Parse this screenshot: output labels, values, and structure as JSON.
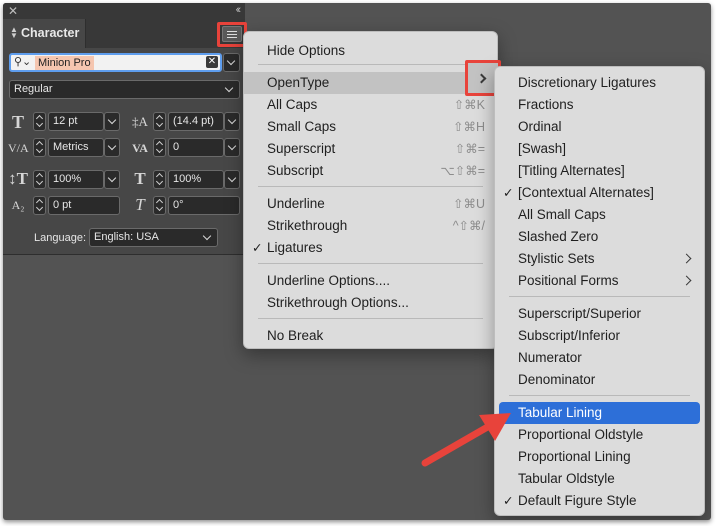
{
  "panel": {
    "tab_label": "Character",
    "close_icon": "close-icon",
    "collapse_glyph": "‹‹",
    "font_family": "Minion Pro",
    "font_style": "Regular",
    "font_size": "12 pt",
    "leading": "(14.4 pt)",
    "kerning": "Metrics",
    "tracking": "0",
    "vertical_scale": "100%",
    "horizontal_scale": "100%",
    "baseline_shift": "0 pt",
    "skew": "0°",
    "language_label": "Language:",
    "language_value": "English: USA"
  },
  "main_menu": {
    "items": [
      {
        "label": "Hide Options",
        "shortcut": "",
        "checked": false,
        "submenu": false
      },
      {
        "label": "OpenType",
        "shortcut": "",
        "checked": false,
        "submenu": true
      },
      {
        "label": "All Caps",
        "shortcut": "⇧⌘K",
        "checked": false,
        "submenu": false
      },
      {
        "label": "Small Caps",
        "shortcut": "⇧⌘H",
        "checked": false,
        "submenu": false
      },
      {
        "label": "Superscript",
        "shortcut": "⇧⌘=",
        "checked": false,
        "submenu": false
      },
      {
        "label": "Subscript",
        "shortcut": "⌥⇧⌘=",
        "checked": false,
        "submenu": false
      },
      {
        "label": "Underline",
        "shortcut": "⇧⌘U",
        "checked": false,
        "submenu": false
      },
      {
        "label": "Strikethrough",
        "shortcut": "^⇧⌘/",
        "checked": false,
        "submenu": false
      },
      {
        "label": "Ligatures",
        "shortcut": "",
        "checked": true,
        "submenu": false
      },
      {
        "label": "Underline Options....",
        "shortcut": "",
        "checked": false,
        "submenu": false
      },
      {
        "label": "Strikethrough Options...",
        "shortcut": "",
        "checked": false,
        "submenu": false
      },
      {
        "label": "No Break",
        "shortcut": "",
        "checked": false,
        "submenu": false
      }
    ]
  },
  "opentype_menu": {
    "items": [
      {
        "label": "Discretionary Ligatures",
        "checked": false,
        "submenu": false
      },
      {
        "label": "Fractions",
        "checked": false,
        "submenu": false
      },
      {
        "label": "Ordinal",
        "checked": false,
        "submenu": false
      },
      {
        "label": "[Swash]",
        "checked": false,
        "submenu": false
      },
      {
        "label": "[Titling Alternates]",
        "checked": false,
        "submenu": false
      },
      {
        "label": "[Contextual Alternates]",
        "checked": true,
        "submenu": false
      },
      {
        "label": "All Small Caps",
        "checked": false,
        "submenu": false
      },
      {
        "label": "Slashed Zero",
        "checked": false,
        "submenu": false
      },
      {
        "label": "Stylistic Sets",
        "checked": false,
        "submenu": true
      },
      {
        "label": "Positional Forms",
        "checked": false,
        "submenu": true
      },
      {
        "label": "Superscript/Superior",
        "checked": false,
        "submenu": false
      },
      {
        "label": "Subscript/Inferior",
        "checked": false,
        "submenu": false
      },
      {
        "label": "Numerator",
        "checked": false,
        "submenu": false
      },
      {
        "label": "Denominator",
        "checked": false,
        "submenu": false
      },
      {
        "label": "Tabular Lining",
        "checked": false,
        "submenu": false,
        "selected": true
      },
      {
        "label": "Proportional Oldstyle",
        "checked": false,
        "submenu": false
      },
      {
        "label": "Proportional Lining",
        "checked": false,
        "submenu": false
      },
      {
        "label": "Tabular Oldstyle",
        "checked": false,
        "submenu": false
      },
      {
        "label": "Default Figure Style",
        "checked": true,
        "submenu": false
      }
    ]
  },
  "colors": {
    "annotation_red": "#e8433b",
    "selection_blue": "#2d6fd8",
    "canvas": "#535353"
  }
}
